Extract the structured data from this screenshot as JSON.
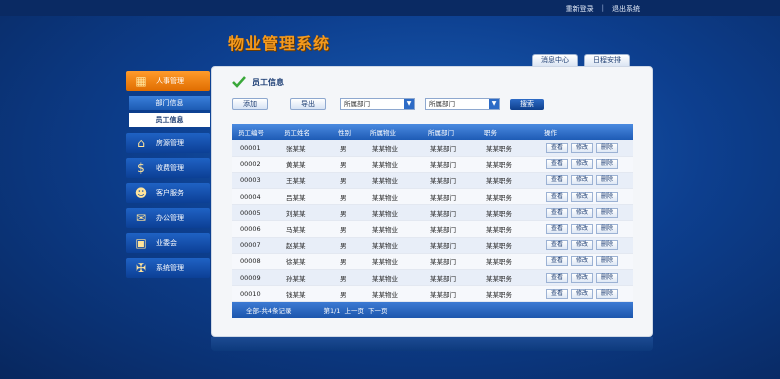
{
  "top_links": {
    "relogin": "重新登录",
    "sep": "|",
    "logout": "退出系统"
  },
  "app_title": "物业管理系统",
  "top_tabs": [
    "消息中心",
    "日程安排"
  ],
  "sidebar": {
    "hr": "人事管理",
    "sub": [
      "部门信息",
      "员工信息"
    ],
    "items": [
      "房源管理",
      "收费管理",
      "客户服务",
      "办公管理",
      "业委会",
      "系统管理"
    ]
  },
  "section_title": "员工信息",
  "toolbar": {
    "add": "添加",
    "export": "导出",
    "select1": "所属部门",
    "select2": "所属部门",
    "search": "搜索"
  },
  "table": {
    "headers": [
      "员工编号",
      "员工姓名",
      "性别",
      "所属物业",
      "所属部门",
      "职务",
      "操作"
    ],
    "ops": [
      "查看",
      "修改",
      "删除"
    ],
    "rows": [
      [
        "00001",
        "张某某",
        "男",
        "某某物业",
        "某某部门",
        "某某职务"
      ],
      [
        "00002",
        "黄某某",
        "男",
        "某某物业",
        "某某部门",
        "某某职务"
      ],
      [
        "00003",
        "王某某",
        "男",
        "某某物业",
        "某某部门",
        "某某职务"
      ],
      [
        "00004",
        "吕某某",
        "男",
        "某某物业",
        "某某部门",
        "某某职务"
      ],
      [
        "00005",
        "刘某某",
        "男",
        "某某物业",
        "某某部门",
        "某某职务"
      ],
      [
        "00006",
        "马某某",
        "男",
        "某某物业",
        "某某部门",
        "某某职务"
      ],
      [
        "00007",
        "赵某某",
        "男",
        "某某物业",
        "某某部门",
        "某某职务"
      ],
      [
        "00008",
        "徐某某",
        "男",
        "某某物业",
        "某某部门",
        "某某职务"
      ],
      [
        "00009",
        "孙某某",
        "男",
        "某某物业",
        "某某部门",
        "某某职务"
      ],
      [
        "00010",
        "钱某某",
        "男",
        "某某物业",
        "某某部门",
        "某某职务"
      ]
    ],
    "footer": {
      "summary": "全部-共4条记录",
      "page": "第1/1",
      "prev": "上一页",
      "next": "下一页"
    }
  },
  "colors": {
    "accent_orange": "#f59a1d",
    "nav_blue": "#0c3f95",
    "table_header": "#1e5bb5"
  }
}
